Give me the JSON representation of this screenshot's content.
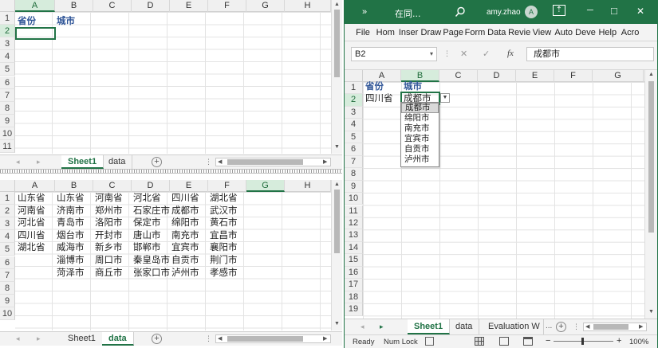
{
  "left_window": {
    "columns": [
      "A",
      "B",
      "C",
      "D",
      "E",
      "F",
      "G",
      "H"
    ],
    "top_pane": {
      "rows": [
        "1",
        "2",
        "3",
        "4",
        "5",
        "6",
        "7",
        "8",
        "9",
        "10",
        "11"
      ],
      "header_row": [
        "省份",
        "城市"
      ],
      "tabs": [
        "Sheet1",
        "data"
      ]
    },
    "bottom_pane": {
      "rows": [
        "1",
        "2",
        "3",
        "4",
        "5",
        "6",
        "7",
        "8",
        "9",
        "10"
      ],
      "data": [
        [
          "山东省",
          "山东省",
          "河南省",
          "河北省",
          "四川省",
          "湖北省"
        ],
        [
          "河南省",
          "济南市",
          "郑州市",
          "石家庄市",
          "成都市",
          "武汉市"
        ],
        [
          "河北省",
          "青岛市",
          "洛阳市",
          "保定市",
          "绵阳市",
          "黄石市"
        ],
        [
          "四川省",
          "烟台市",
          "开封市",
          "唐山市",
          "南充市",
          "宜昌市"
        ],
        [
          "湖北省",
          "威海市",
          "新乡市",
          "邯郸市",
          "宜宾市",
          "襄阳市"
        ],
        [
          "",
          "淄博市",
          "周口市",
          "秦皇岛市",
          "自贡市",
          "荆门市"
        ],
        [
          "",
          "菏泽市",
          "商丘市",
          "张家口市",
          "泸州市",
          "孝感市"
        ]
      ],
      "tabs": [
        "Sheet1",
        "data"
      ]
    },
    "plus_label": "+"
  },
  "right_window": {
    "title": {
      "chevrons": "»",
      "doc": "在同...",
      "user": "amy.zhao",
      "avatar": "A",
      "minimize": "─",
      "restore": "□",
      "close": "✕"
    },
    "ribbon_tabs": [
      "File",
      "Hom",
      "Inser",
      "Draw",
      "Page",
      "Form",
      "Data",
      "Revie",
      "View",
      "Auto",
      "Deve",
      "Help",
      "Acro"
    ],
    "name_box": "B2",
    "fx": "fx",
    "formula_value": "成都市",
    "cancel": "✕",
    "enter": "✓",
    "columns": [
      "A",
      "B",
      "C",
      "D",
      "E",
      "F",
      "G"
    ],
    "rows": [
      "1",
      "2",
      "3",
      "4",
      "5",
      "6",
      "7",
      "8",
      "9",
      "10",
      "11",
      "12",
      "13",
      "14",
      "15",
      "16",
      "17",
      "18",
      "19"
    ],
    "header_row": [
      "省份",
      "城市"
    ],
    "row2": [
      "四川省",
      "成都市"
    ],
    "dropdown_items": [
      "成都市",
      "绵阳市",
      "南充市",
      "宜宾市",
      "自贡市",
      "泸州市"
    ],
    "tabs": [
      "Sheet1",
      "data",
      "Evaluation W"
    ],
    "ellipsis": "...",
    "plus_label": "+",
    "status": {
      "ready": "Ready",
      "numlock": "Num Lock",
      "zoom": "100%",
      "minus": "−",
      "plus": "+"
    }
  },
  "colors": {
    "accent": "#217346",
    "header_text": "#2f5597"
  }
}
